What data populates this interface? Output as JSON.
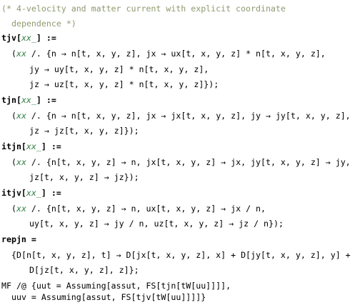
{
  "code": {
    "comment_line_1": "(* 4-velocity and matter current with explicit coordinate",
    "comment_line_2": "dependence *)",
    "def_tjv": {
      "name": "tjv",
      "open": "[",
      "pattern": "xx_",
      "close": "] :="
    },
    "tjv_1_open": "(",
    "tjv_1_xx": "xx",
    "tjv_1_rest": " /. {n → n[t, x, y, z], jx → ux[t, x, y, z] * n[t, x, y, z],",
    "tjv_2": "jy → uy[t, x, y, z] * n[t, x, y, z],",
    "tjv_3": "jz → uz[t, x, y, z] * n[t, x, y, z]});",
    "def_tjn": {
      "name": "tjn",
      "open": "[",
      "pattern": "xx_",
      "close": "] :="
    },
    "tjn_1_open": "(",
    "tjn_1_xx": "xx",
    "tjn_1_rest": " /. {n → n[t, x, y, z], jx → jx[t, x, y, z], jy → jy[t, x, y, z],",
    "tjn_2": "jz → jz[t, x, y, z]});",
    "def_itjn": {
      "name": "itjn",
      "open": "[",
      "pattern": "xx_",
      "close": "] :="
    },
    "itjn_1_open": "(",
    "itjn_1_xx": "xx",
    "itjn_1_rest": " /. {n[t, x, y, z] → n, jx[t, x, y, z] → jx, jy[t, x, y, z] → jy,",
    "itjn_2": "jz[t, x, y, z] → jz});",
    "def_itjv": {
      "name": "itjv",
      "open": "[",
      "pattern": "xx_",
      "close": "] :="
    },
    "itjv_1_open": "(",
    "itjv_1_xx": "xx",
    "itjv_1_rest": " /. {n[t, x, y, z] → n, ux[t, x, y, z] → jx / n,",
    "itjv_2": "uy[t, x, y, z] → jy / n, uz[t, x, y, z] → jz / n});",
    "repjn_head": "repjn",
    "repjn_eq": " =",
    "repjn_1": "{D[n[t, x, y, z], t] → D[jx[t, x, y, z], x] + D[jy[t, x, y, z], y] +",
    "repjn_2": "D[jz[t, x, y, z], z]};",
    "mf_1": "MF /@ {uut = Assuming[assut, FS[tjn[tW[uu]]]],",
    "mf_2": "uuv = Assuming[assut, FS[tjv[tW[uu]]]]}"
  },
  "colors": {
    "comment": "#8e9a6f",
    "pattern": "#2f7d43",
    "text": "#000000",
    "background": "#ffffff"
  }
}
